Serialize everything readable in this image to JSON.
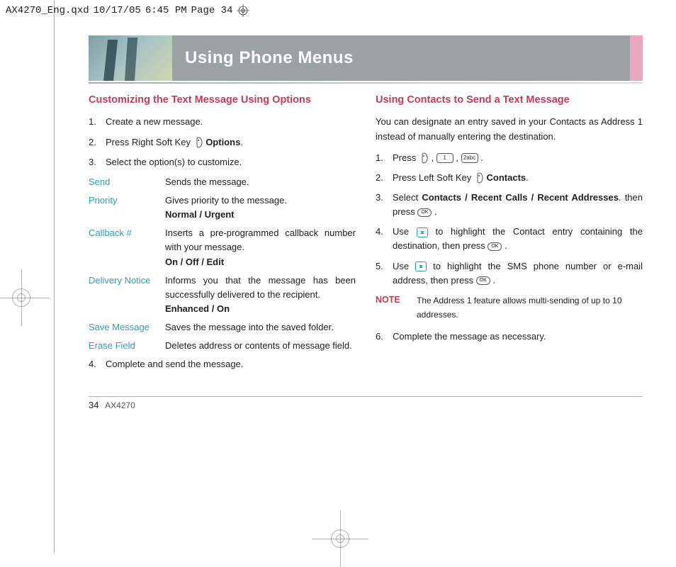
{
  "slug": {
    "file": "AX4270_Eng.qxd",
    "date": "10/17/05",
    "time": "6:45 PM",
    "page": "Page 34"
  },
  "banner": {
    "title": "Using Phone Menus"
  },
  "left": {
    "heading": "Customizing the Text Message Using Options",
    "steps": {
      "s1": "Create a new message.",
      "s2a": "Press Right Soft Key ",
      "s2b": "Options",
      "s3": "Select the option(s) to customize.",
      "s4": "Complete and send the message."
    },
    "options": [
      {
        "name": "Send",
        "desc": "Sends the message.",
        "sub": ""
      },
      {
        "name": "Priority",
        "desc": "Gives priority to the message.",
        "sub": "Normal / Urgent"
      },
      {
        "name": "Callback #",
        "desc": "Inserts a pre-programmed callback number with your message.",
        "sub": "On / Off / Edit"
      },
      {
        "name": "Delivery Notice",
        "desc": "Informs you that the message has been successfully delivered to the recipient.",
        "sub": "Enhanced / On"
      },
      {
        "name": "Save Message",
        "desc": "Saves the message into the saved folder.",
        "sub": ""
      },
      {
        "name": "Erase Field",
        "desc": "Deletes address or contents of message field.",
        "sub": ""
      }
    ]
  },
  "right": {
    "heading": "Using Contacts to Send a Text Message",
    "intro": "You can designate an entry saved in your Contacts as Address 1 instead of manually entering the destination.",
    "s1a": "Press ",
    "s2a": "Press Left Soft Key ",
    "s2b": "Contacts",
    "s3a": "Select ",
    "s3b": "Contacts / Recent Calls / Recent Addresses",
    "s3c": ". then press ",
    "s4a": "Use ",
    "s4b": " to highlight the Contact entry containing the destination, then press ",
    "s5a": "Use ",
    "s5b": " to highlight the SMS phone number or e-mail address, then press ",
    "note_label": "NOTE",
    "note_text": "The Address 1 feature allows multi-sending of up to 10 addresses.",
    "s6": "Complete the message as necessary."
  },
  "keys": {
    "k1": "1",
    "k2": "2abc",
    "ok": "OK"
  },
  "footer": {
    "pagenum": "34",
    "model": "AX4270"
  }
}
